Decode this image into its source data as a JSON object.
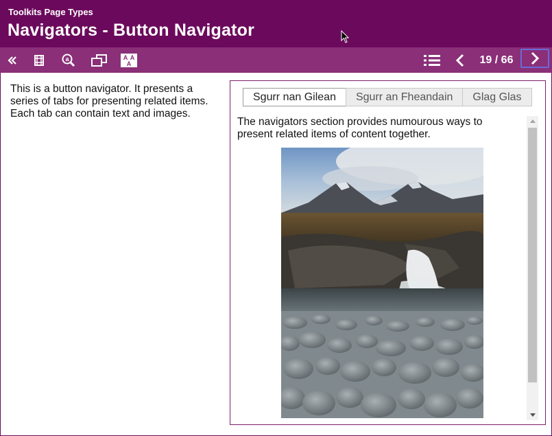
{
  "header": {
    "supertitle": "Toolkits Page Types",
    "title": "Navigators - Button Navigator"
  },
  "toolbar": {
    "left_icons": [
      "collapse-icon",
      "filmstrip-icon",
      "search-icon",
      "windows-icon",
      "text-size-icon"
    ],
    "right_icons": [
      "menu-list-icon",
      "previous-page-icon",
      "next-page-icon"
    ],
    "page_counter": "19 / 66"
  },
  "left": {
    "text": "This is a button navigator. It presents a series of tabs for presenting related items. Each tab can contain text and images."
  },
  "navigator": {
    "tabs": [
      {
        "label": "Sgurr nan Gilean",
        "active": true
      },
      {
        "label": "Sgurr an Fheandain",
        "active": false
      },
      {
        "label": "Glag Glas",
        "active": false
      }
    ],
    "content_text": "The navigators section provides numourous ways to present related items of content together."
  },
  "colors": {
    "header_bg": "#6b0a5c",
    "toolbar_bg": "#8a2f78",
    "accent_focus": "#6a6ad8"
  }
}
